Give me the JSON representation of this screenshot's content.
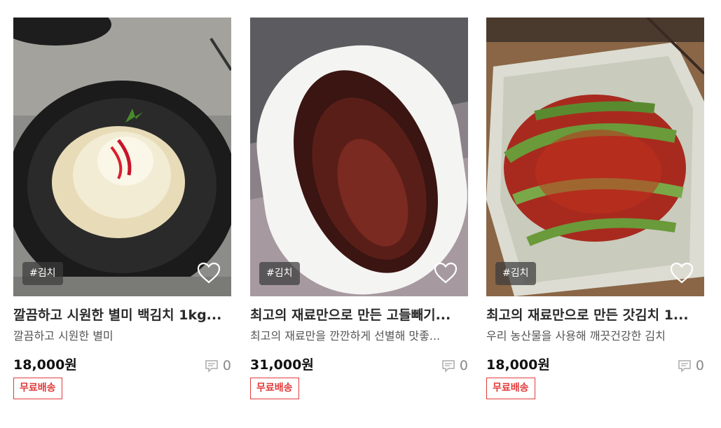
{
  "colors": {
    "accent_red": "#e23b3b",
    "tag_bg": "#3c3c3c"
  },
  "products": [
    {
      "tag": "#김치",
      "title": "깔끔하고 시원한 별미 백김치 1kg...",
      "subtitle": "깔끔하고 시원한 별미",
      "price": "18,000원",
      "comment_count": "0",
      "shipping_badge": "무료배송",
      "image_desc_icon": "white-kimchi-photo"
    },
    {
      "tag": "#김치",
      "title": "최고의 재료만으로 만든 고들빼기...",
      "subtitle": "최고의 재료만을 깐깐하게 선별해 맛좋...",
      "price": "31,000원",
      "comment_count": "0",
      "shipping_badge": "무료배송",
      "image_desc_icon": "godeulppaegi-kimchi-photo"
    },
    {
      "tag": "#김치",
      "title": "최고의 재료만으로 만든 갓김치 1...",
      "subtitle": "우리 농산물을 사용해 깨끗건강한 김치",
      "price": "18,000원",
      "comment_count": "0",
      "shipping_badge": "무료배송",
      "image_desc_icon": "mustard-leaf-kimchi-photo"
    }
  ]
}
